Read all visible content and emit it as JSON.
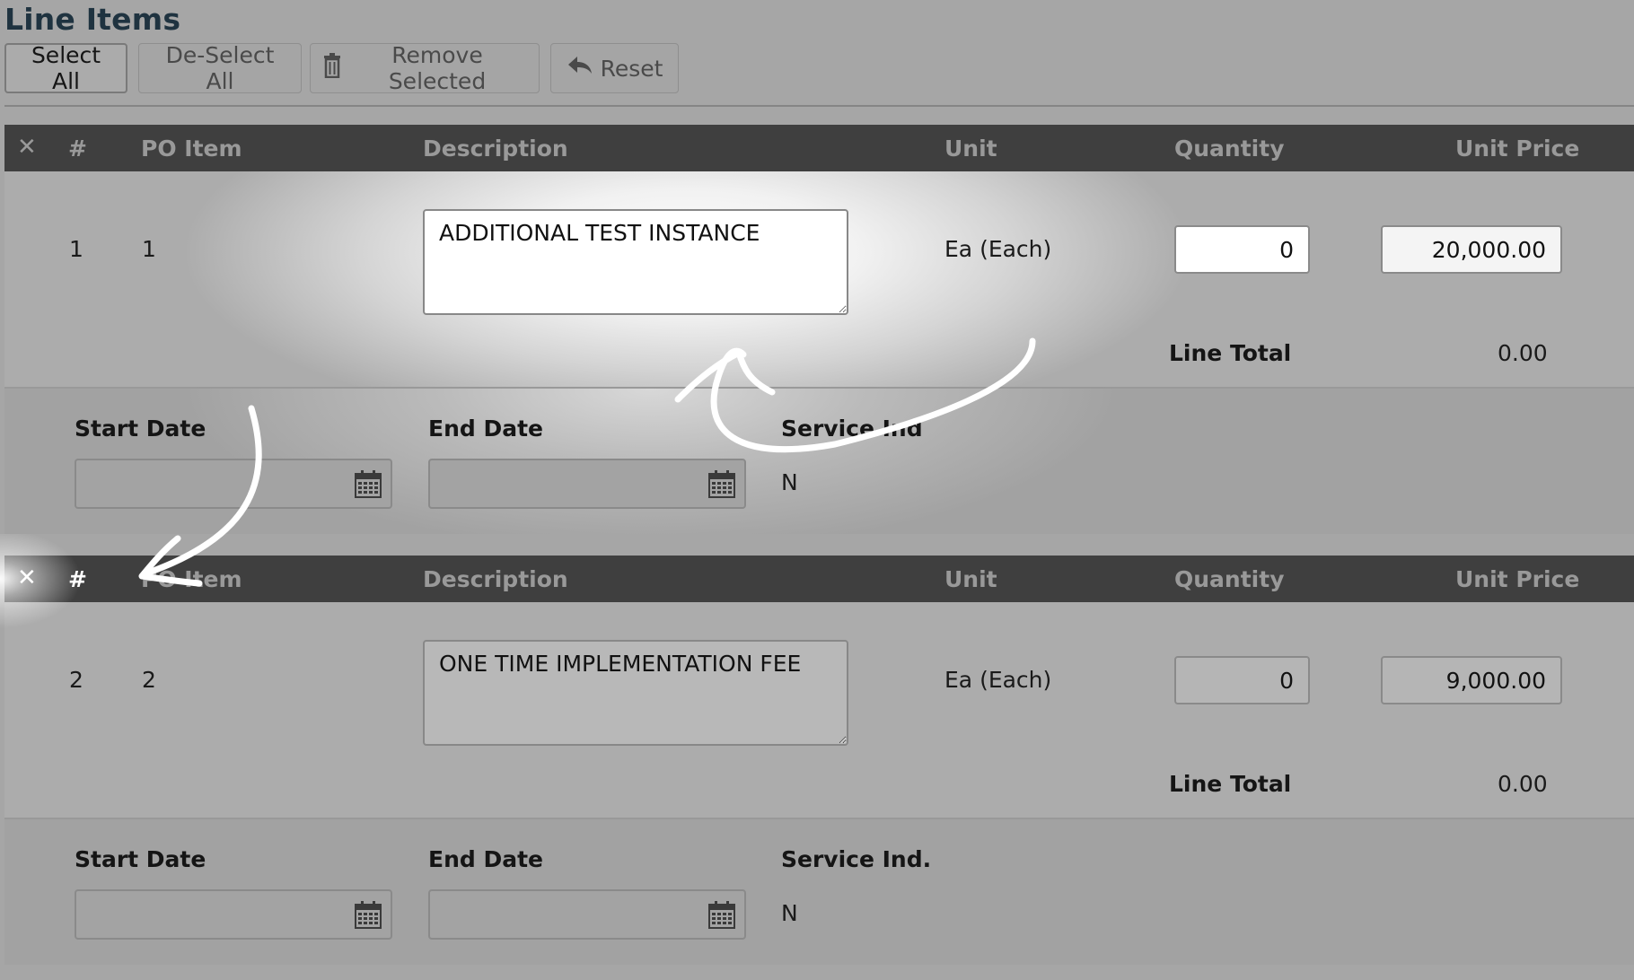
{
  "page_title": "Line Items",
  "toolbar": {
    "select_all": "Select All",
    "deselect_all": "De-Select All",
    "remove_selected": "Remove Selected",
    "reset": "Reset"
  },
  "columns": {
    "remove": "✕",
    "number": "#",
    "po_item": "PO Item",
    "description": "Description",
    "unit": "Unit",
    "quantity": "Quantity",
    "unit_price": "Unit Price"
  },
  "items": [
    {
      "number": "1",
      "po_item": "1",
      "description": "ADDITIONAL TEST INSTANCE",
      "unit": "Ea (Each)",
      "quantity": "0",
      "unit_price": "20,000.00",
      "line_total_label": "Line Total",
      "line_total": "0.00",
      "start_date_label": "Start Date",
      "start_date": "",
      "end_date_label": "End Date",
      "end_date": "",
      "service_ind_label": "Service Ind",
      "service_ind": "N"
    },
    {
      "number": "2",
      "po_item": "2",
      "description": "ONE TIME IMPLEMENTATION FEE",
      "unit": "Ea (Each)",
      "quantity": "0",
      "unit_price": "9,000.00",
      "line_total_label": "Line Total",
      "line_total": "0.00",
      "start_date_label": "Start Date",
      "start_date": "",
      "end_date_label": "End Date",
      "end_date": "",
      "service_ind_label": "Service Ind.",
      "service_ind": "N"
    }
  ],
  "icons": {
    "remove": "close-icon",
    "trash": "trash-icon",
    "reset": "reply-arrow-icon",
    "calendar": "calendar-icon"
  },
  "colors": {
    "header_bg": "#3f3f3f",
    "title": "#1f3340",
    "annotation": "#ffffff"
  }
}
